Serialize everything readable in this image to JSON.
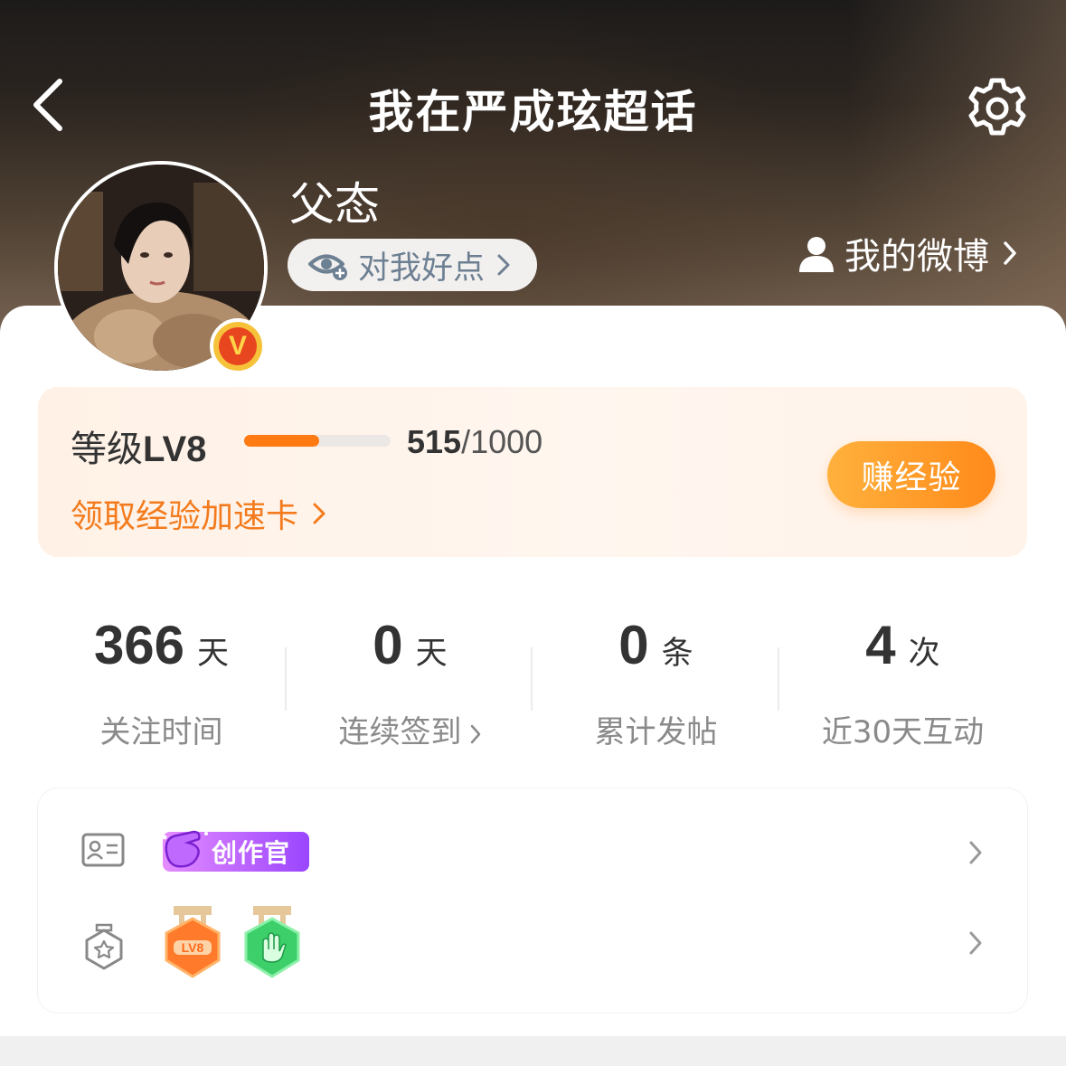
{
  "header": {
    "title": "我在严成玹超话",
    "username": "父态",
    "kindness_pill": "对我好点",
    "my_weibo": "我的微博"
  },
  "level": {
    "label": "等级",
    "level_name": "LV8",
    "current_exp": "515",
    "max_exp": "/1000",
    "progress": 0.515,
    "boost_link": "领取经验加速卡",
    "earn_button": "赚经验"
  },
  "stats": [
    {
      "value": "366",
      "unit": "天",
      "label": "关注时间"
    },
    {
      "value": "0",
      "unit": "天",
      "label": "连续签到"
    },
    {
      "value": "0",
      "unit": "条",
      "label": "累计发帖"
    },
    {
      "value": "4",
      "unit": "次",
      "label": "近30天互动"
    }
  ],
  "badges": {
    "creator_badge": "创作官",
    "medals": [
      {
        "name": "LV8 medal",
        "icon": "lv8-medal-icon",
        "color": "#ff7a2a",
        "text": "LV8"
      },
      {
        "name": "interaction medal",
        "icon": "hand-medal-icon",
        "color": "#3ccf6a"
      }
    ]
  },
  "colors": {
    "accent_orange": "#ff7a12",
    "link_orange": "#f37b1d",
    "creator_purple": "#b45cff",
    "badge_v": "#e8461e"
  }
}
